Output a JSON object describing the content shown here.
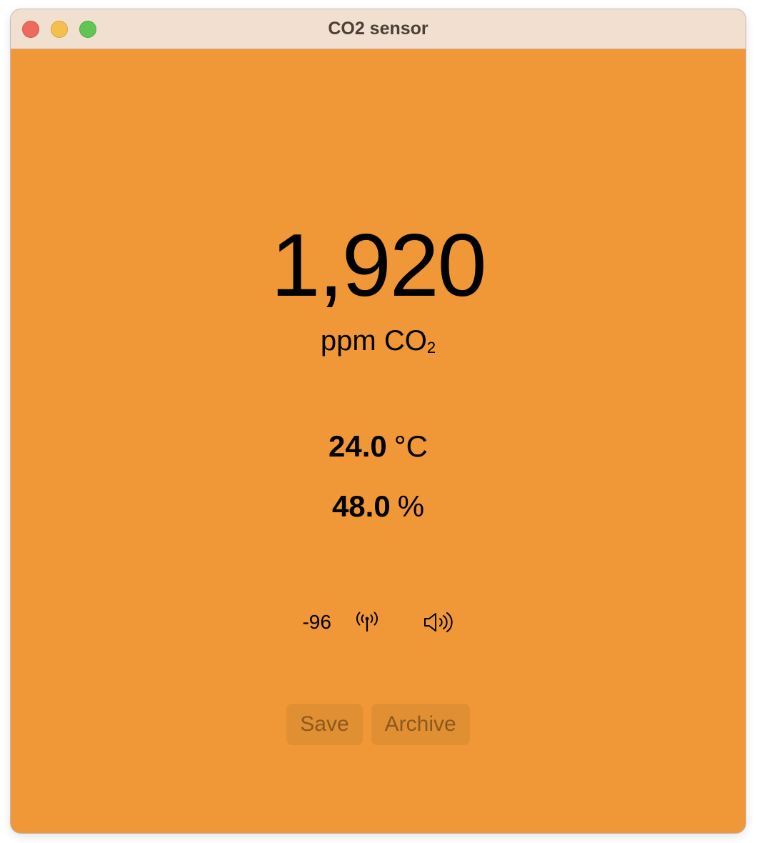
{
  "window": {
    "title": "CO2 sensor",
    "background_color": "#f09837"
  },
  "co2": {
    "value": "1,920",
    "unit": "ppm CO",
    "unit_subscript": "2"
  },
  "temperature": {
    "value": "24.0",
    "unit": "°C"
  },
  "humidity": {
    "value": "48.0",
    "unit": "%"
  },
  "status": {
    "rssi": "-96",
    "signal_icon": "antenna-icon",
    "sound_icon": "speaker-icon"
  },
  "actions": {
    "save_label": "Save",
    "archive_label": "Archive"
  }
}
